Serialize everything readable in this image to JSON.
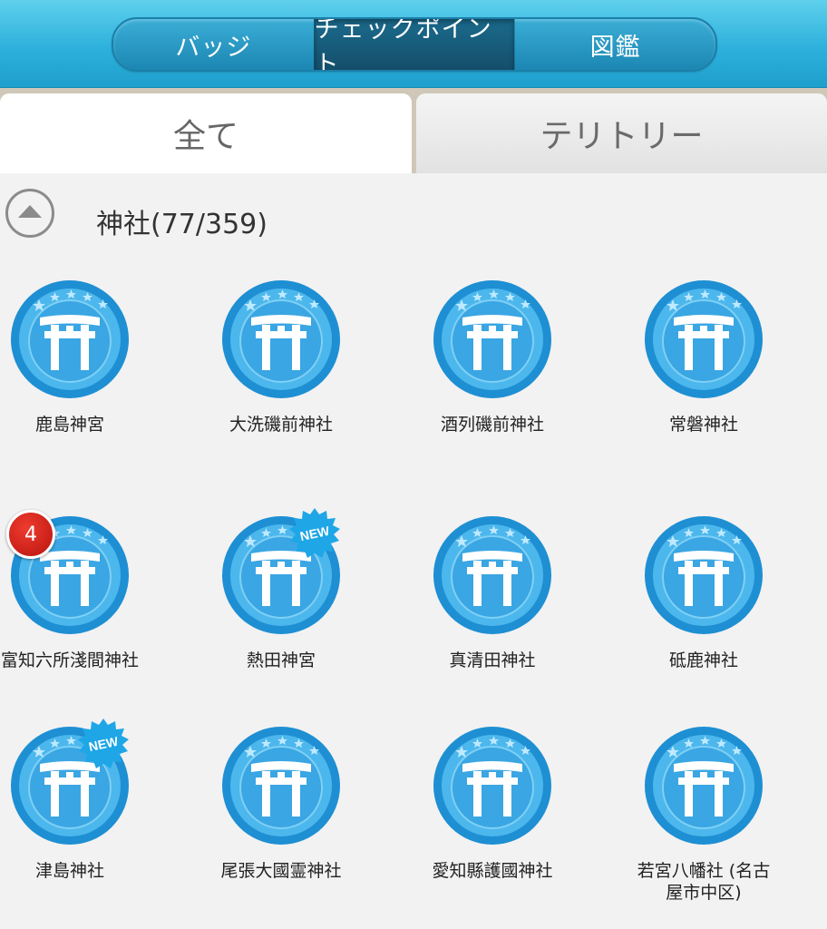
{
  "header": {
    "segments": [
      {
        "label": "バッジ",
        "active": false
      },
      {
        "label": "チェックポイント",
        "active": true
      },
      {
        "label": "図鑑",
        "active": false
      }
    ]
  },
  "tabs": [
    {
      "label": "全て",
      "active": true
    },
    {
      "label": "テリトリー",
      "active": false
    }
  ],
  "section": {
    "title": "神社(77/359)"
  },
  "checkpoints": [
    {
      "name": "鹿島神宮"
    },
    {
      "name": "大洗磯前神社"
    },
    {
      "name": "酒列磯前神社"
    },
    {
      "name": "常磐神社"
    },
    {
      "name": "富知六所淺間神社",
      "count": "4"
    },
    {
      "name": "熱田神宮",
      "new_label": "NEW"
    },
    {
      "name": "真清田神社"
    },
    {
      "name": "砥鹿神社"
    },
    {
      "name": "津島神社",
      "new_label": "NEW"
    },
    {
      "name": "尾張大國霊神社"
    },
    {
      "name": "愛知縣護國神社"
    },
    {
      "name": "若宮八幡社 (名古屋市中区)"
    }
  ],
  "colors": {
    "badge_outer": "#1e8fd3",
    "badge_ring": "#4cb7ec",
    "badge_inner": "#3aa6e3",
    "torii": "#ffffff",
    "header": "#2db1dc"
  },
  "icons": {
    "badge": "torii-gate-icon",
    "collapse": "chevron-up-icon"
  }
}
